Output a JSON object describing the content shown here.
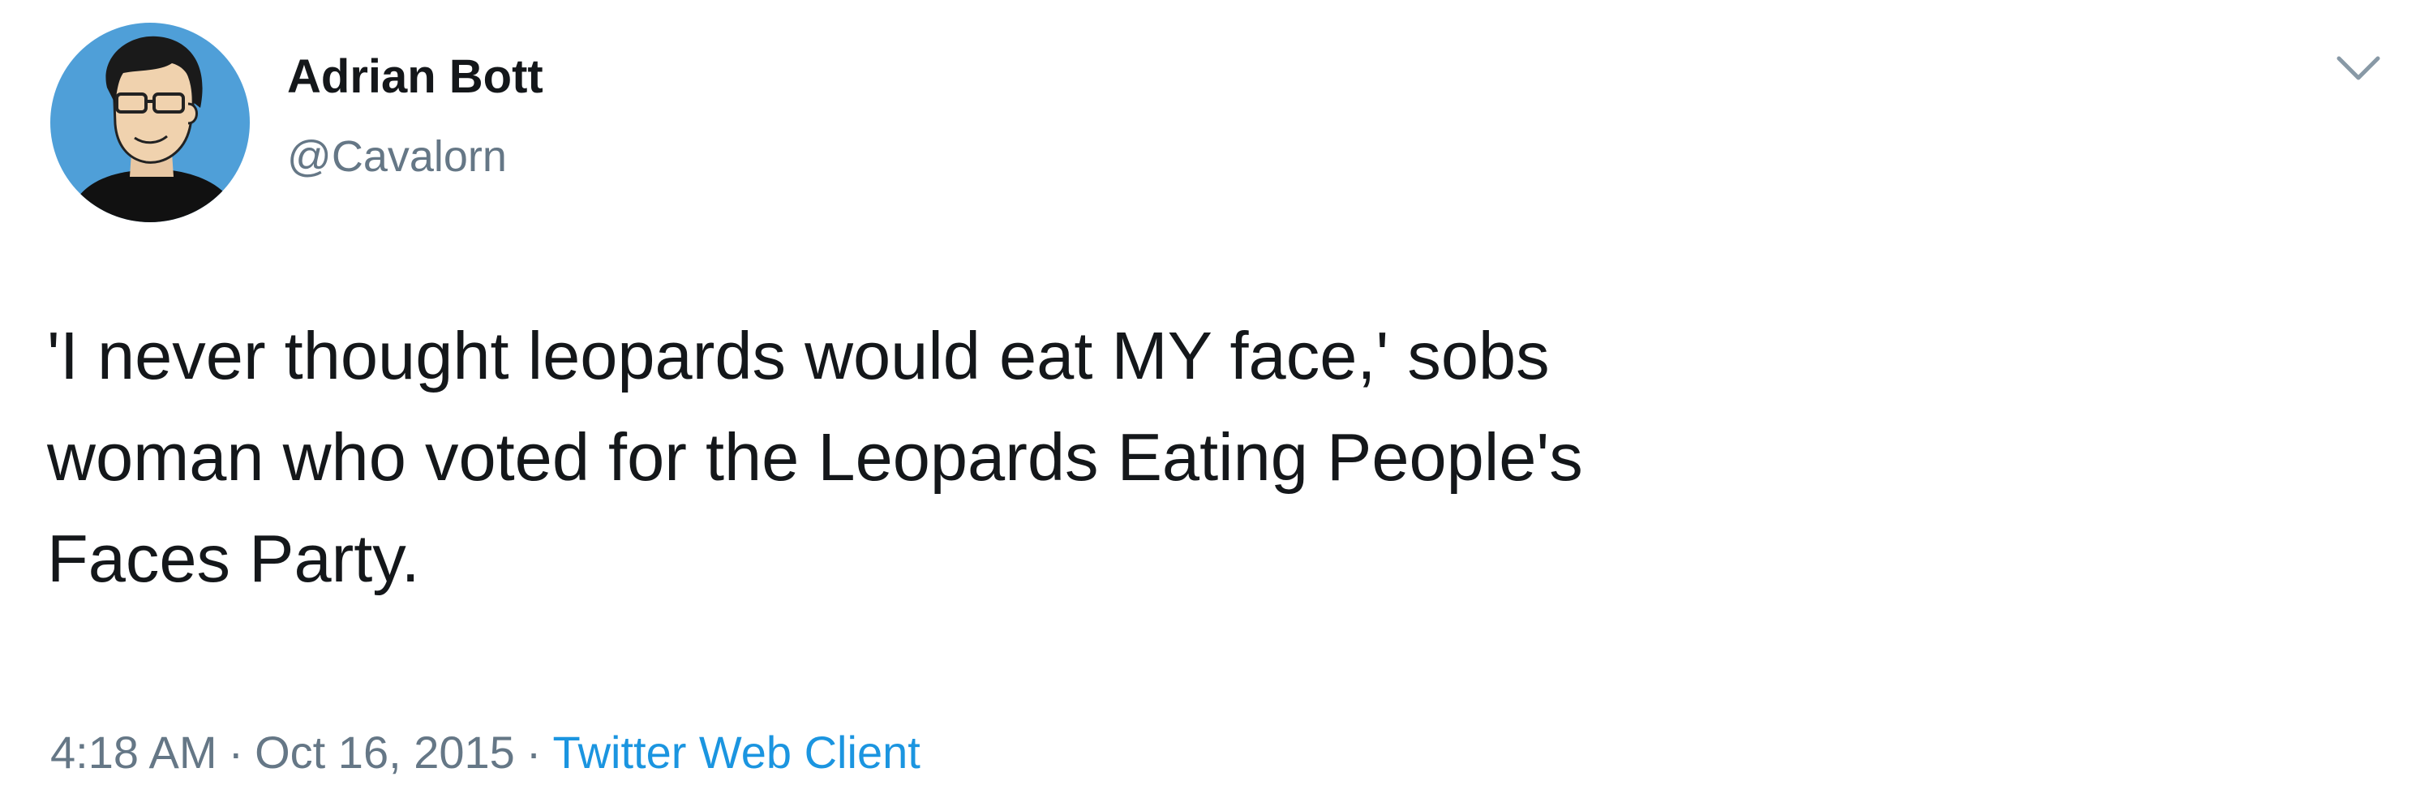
{
  "tweet": {
    "author": {
      "display_name": "Adrian Bott",
      "handle": "@Cavalorn",
      "avatar_icon": "cartoon-portrait-avatar"
    },
    "menu_icon": "chevron-down-icon",
    "text": "'I never thought leopards would eat MY face,' sobs\nwoman who voted for the Leopards Eating People's\nFaces Party.",
    "time": "4:18 AM",
    "separator": "·",
    "date": "Oct 16, 2015",
    "source": "Twitter Web Client"
  },
  "colors": {
    "text": "#14171a",
    "secondary": "#657786",
    "link": "#1b95e0",
    "avatar_background": "#4f9fd8"
  }
}
